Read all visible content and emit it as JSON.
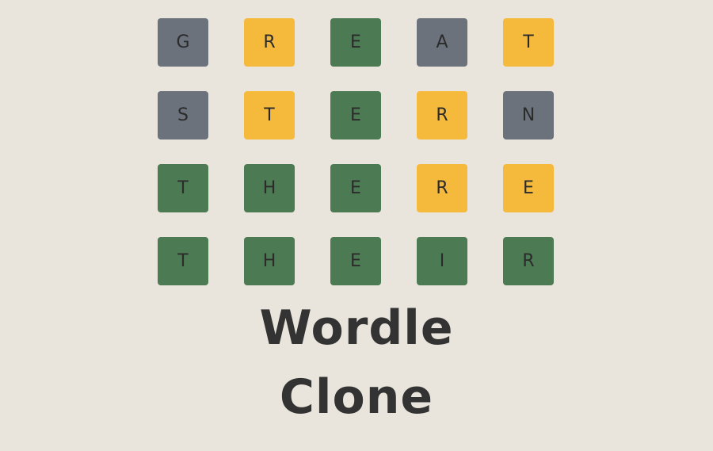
{
  "colors": {
    "background": "#e9e5dc",
    "absent": "#6b727b",
    "present": "#f5b93c",
    "correct": "#4c7a53",
    "text": "#2b2b2b",
    "title": "#333333"
  },
  "board": {
    "rows": [
      {
        "tiles": [
          {
            "letter": "G",
            "state": "absent"
          },
          {
            "letter": "R",
            "state": "present"
          },
          {
            "letter": "E",
            "state": "correct"
          },
          {
            "letter": "A",
            "state": "absent"
          },
          {
            "letter": "T",
            "state": "present"
          }
        ]
      },
      {
        "tiles": [
          {
            "letter": "S",
            "state": "absent"
          },
          {
            "letter": "T",
            "state": "present"
          },
          {
            "letter": "E",
            "state": "correct"
          },
          {
            "letter": "R",
            "state": "present"
          },
          {
            "letter": "N",
            "state": "absent"
          }
        ]
      },
      {
        "tiles": [
          {
            "letter": "T",
            "state": "correct"
          },
          {
            "letter": "H",
            "state": "correct"
          },
          {
            "letter": "E",
            "state": "correct"
          },
          {
            "letter": "R",
            "state": "present"
          },
          {
            "letter": "E",
            "state": "present"
          }
        ]
      },
      {
        "tiles": [
          {
            "letter": "T",
            "state": "correct"
          },
          {
            "letter": "H",
            "state": "correct"
          },
          {
            "letter": "E",
            "state": "correct"
          },
          {
            "letter": "I",
            "state": "correct"
          },
          {
            "letter": "R",
            "state": "correct"
          }
        ]
      }
    ]
  },
  "title": {
    "line1": "Wordle",
    "line2": "Clone"
  }
}
